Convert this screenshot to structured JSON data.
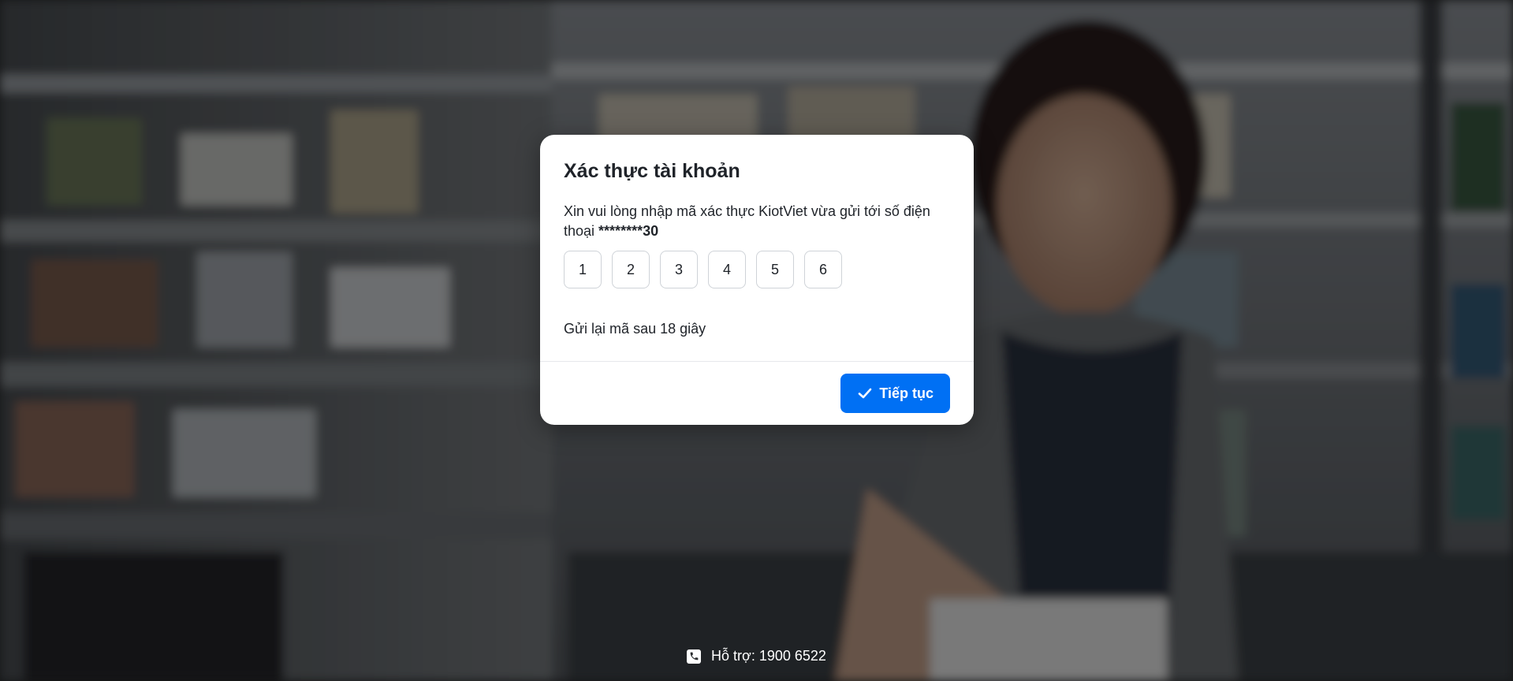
{
  "dialog": {
    "title": "Xác thực tài khoản",
    "description_prefix": "Xin vui lòng nhập mã xác thực KiotViet vừa gửi tới số điện thoại ",
    "masked_phone": "********30",
    "otp_digits": [
      "1",
      "2",
      "3",
      "4",
      "5",
      "6"
    ],
    "resend_text": "Gửi lại mã sau 18 giây",
    "continue_label": "Tiếp tục"
  },
  "support": {
    "label": "Hỗ trợ: 1900 6522"
  },
  "colors": {
    "primary_button": "#0070f4",
    "text": "#1f2329",
    "otp_border": "#cfd3d8"
  },
  "icons": {
    "continue": "check-icon",
    "support": "phone-icon"
  }
}
